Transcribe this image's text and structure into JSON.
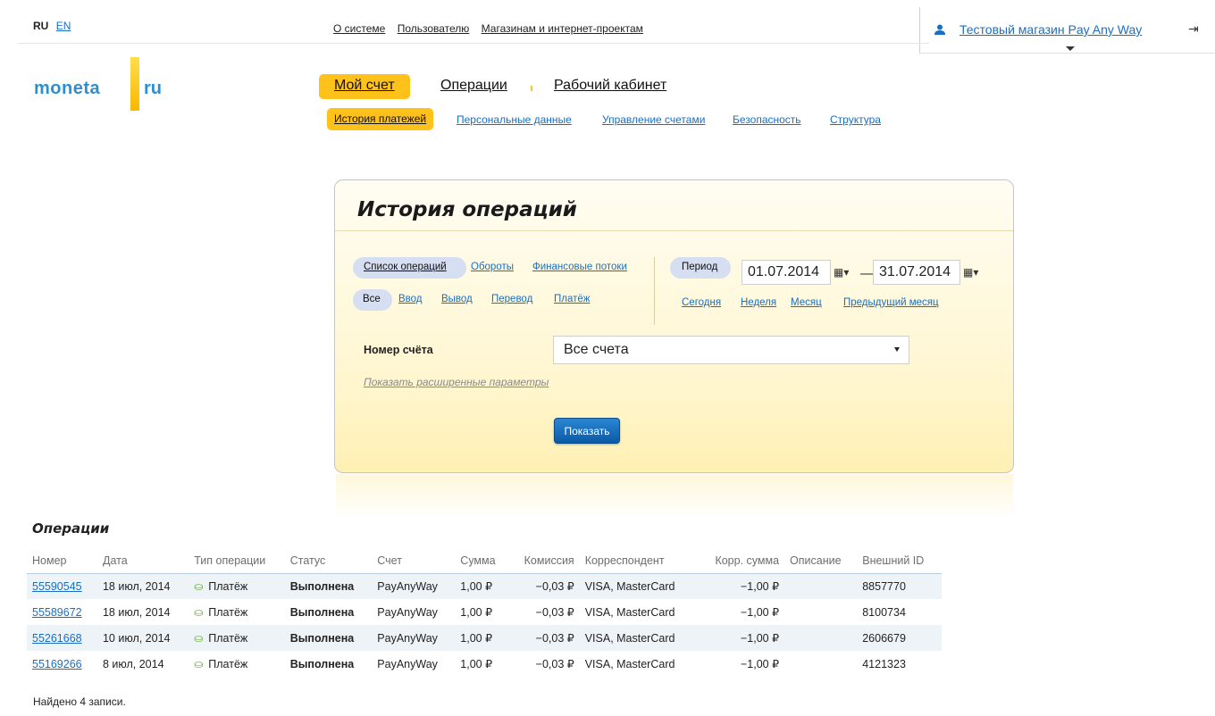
{
  "top": {
    "lang_current": "RU",
    "lang_other": "EN",
    "nav": [
      "О системе",
      "Пользователю",
      "Магазинам и интернет-проектам"
    ],
    "user_name": "Тестовый магазин Pay Any Way",
    "user_icon": "user-icon",
    "exit_icon": "exit-icon"
  },
  "logo": {
    "left": "moneta",
    "right": "ru"
  },
  "mainnav": {
    "items": [
      "Мой счет",
      "Операции",
      "Рабочий кабинет"
    ]
  },
  "subnav": {
    "items": [
      "История платежей",
      "Персональные данные",
      "Управление счетами",
      "Безопасность",
      "Структура"
    ]
  },
  "panel": {
    "title": "История операций",
    "views": [
      "Список операций",
      "Обороты",
      "Финансовые потоки"
    ],
    "types": [
      "Все",
      "Ввод",
      "Вывод",
      "Перевод",
      "Платёж"
    ],
    "period_label": "Период",
    "date_from": "01.07.2014",
    "date_to": "31.07.2014",
    "date_sep": "—",
    "quick_periods": [
      "Сегодня",
      "Неделя",
      "Месяц",
      "Предыдущий месяц"
    ],
    "account_label": "Номер счёта",
    "account_value": "Все счета",
    "advanced_link": "Показать расширенные параметры",
    "show_button": "Показать"
  },
  "operations": {
    "title": "Операции",
    "columns": [
      "Номер",
      "Дата",
      "Тип операции",
      "Статус",
      "Счет",
      "Сумма",
      "Комиссия",
      "Корреспондент",
      "Корр. сумма",
      "Описание",
      "Внешний ID"
    ],
    "rows": [
      {
        "id": "55590545",
        "date": "18 июл, 2014",
        "type": "Платёж",
        "status": "Выполнена",
        "account": "PayAnyWay",
        "amount": "1,00 ₽",
        "fee": "−0,03 ₽",
        "corr": "VISA, MasterCard",
        "corr_amount": "−1,00 ₽",
        "desc": "",
        "ext_id": "8857770"
      },
      {
        "id": "55589672",
        "date": "18 июл, 2014",
        "type": "Платёж",
        "status": "Выполнена",
        "account": "PayAnyWay",
        "amount": "1,00 ₽",
        "fee": "−0,03 ₽",
        "corr": "VISA, MasterCard",
        "corr_amount": "−1,00 ₽",
        "desc": "",
        "ext_id": "8100734"
      },
      {
        "id": "55261668",
        "date": "10 июл, 2014",
        "type": "Платёж",
        "status": "Выполнена",
        "account": "PayAnyWay",
        "amount": "1,00 ₽",
        "fee": "−0,03 ₽",
        "corr": "VISA, MasterCard",
        "corr_amount": "−1,00 ₽",
        "desc": "",
        "ext_id": "2606679"
      },
      {
        "id": "55169266",
        "date": "8 июл, 2014",
        "type": "Платёж",
        "status": "Выполнена",
        "account": "PayAnyWay",
        "amount": "1,00 ₽",
        "fee": "−0,03 ₽",
        "corr": "VISA, MasterCard",
        "corr_amount": "−1,00 ₽",
        "desc": "",
        "ext_id": "4121323"
      }
    ],
    "found_text": "Найдено 4 записи."
  }
}
